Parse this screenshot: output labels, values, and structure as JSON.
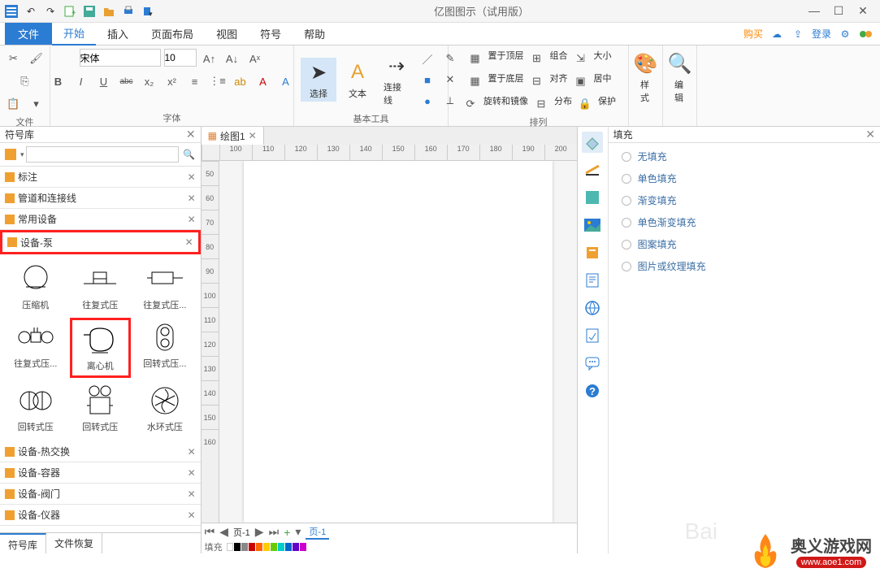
{
  "app_title": "亿图图示（试用版）",
  "qat_icons": [
    "menu",
    "undo",
    "redo",
    "new",
    "save",
    "open",
    "print",
    "export"
  ],
  "win": {
    "min": "—",
    "max": "☐",
    "close": "✕"
  },
  "menubar": {
    "file": "文件",
    "items": [
      "开始",
      "插入",
      "页面布局",
      "视图",
      "符号",
      "帮助"
    ],
    "buy": "购买",
    "login": "登录"
  },
  "ribbon": {
    "file_group": "文件",
    "font_group": "字体",
    "font_name": "宋体",
    "font_size": "10",
    "bold": "B",
    "italic": "I",
    "underline": "U",
    "strike": "abc",
    "tools_group": "基本工具",
    "select": "选择",
    "text": "文本",
    "connector": "连接线",
    "arrange_group": "排列",
    "to_front": "置于顶层",
    "to_back": "置于底层",
    "rotate": "旋转和镜像",
    "group": "组合",
    "align": "对齐",
    "distribute": "分布",
    "size": "大小",
    "center": "居中",
    "protect": "保护",
    "style": "样式",
    "edit": "编辑"
  },
  "left": {
    "title": "符号库",
    "cats": [
      "标注",
      "管道和连接线",
      "常用设备",
      "设备-泵",
      "设备-热交换",
      "设备-容器",
      "设备-阀门",
      "设备-仪器"
    ],
    "shapes": [
      "压缩机",
      "往复式压",
      "往复式压...",
      "往复式压...",
      "离心机",
      "回转式压...",
      "回转式压",
      "回转式压",
      "水环式压"
    ],
    "bottom_tabs": [
      "符号库",
      "文件恢复"
    ]
  },
  "doc_tab": {
    "name": "绘图1"
  },
  "ruler_h": [
    "100",
    "110",
    "120",
    "130",
    "140",
    "150",
    "160",
    "170",
    "180",
    "190",
    "200"
  ],
  "ruler_v": [
    "50",
    "60",
    "70",
    "80",
    "90",
    "100",
    "110",
    "120",
    "130",
    "140",
    "150",
    "160"
  ],
  "canvas_footer": {
    "page_nav": "页-1",
    "page_label": "页-1",
    "fill_label": "填充"
  },
  "right": {
    "title": "填充",
    "opts": [
      "无填充",
      "单色填充",
      "渐变填充",
      "单色渐变填充",
      "图案填充",
      "图片或纹理填充"
    ]
  },
  "watermark": {
    "brand": "奥义游戏网",
    "url": "www.aoe1.com",
    "baidu": "Bai"
  }
}
